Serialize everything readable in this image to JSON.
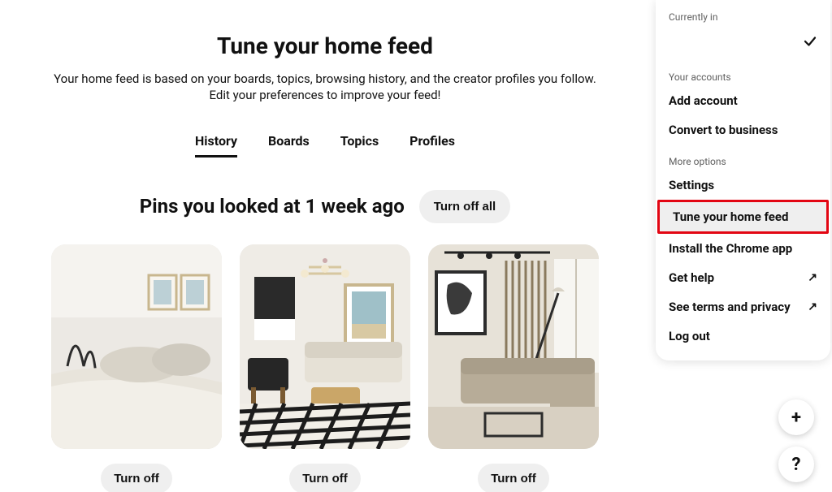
{
  "header": {
    "title": "Tune your home feed",
    "subtitle_line1": "Your home feed is based on your boards, topics, browsing history, and the creator profiles you follow.",
    "subtitle_line2": "Edit your preferences to improve your feed!"
  },
  "tabs": {
    "history": "History",
    "boards": "Boards",
    "topics": "Topics",
    "profiles": "Profiles",
    "active": "history"
  },
  "section": {
    "title": "Pins you looked at 1 week ago",
    "turn_off_all": "Turn off all"
  },
  "pins": [
    {
      "turn_off": "Turn off",
      "alt": "bedroom-interior"
    },
    {
      "turn_off": "Turn off",
      "alt": "living-room-plaid-rug"
    },
    {
      "turn_off": "Turn off",
      "alt": "modern-living-room"
    }
  ],
  "panel": {
    "currently_in_label": "Currently in",
    "your_accounts_label": "Your accounts",
    "add_account": "Add account",
    "convert_business": "Convert to business",
    "more_options_label": "More options",
    "settings": "Settings",
    "tune_feed": "Tune your home feed",
    "install_chrome": "Install the Chrome app",
    "get_help": "Get help",
    "see_terms": "See terms and privacy",
    "log_out": "Log out",
    "external_glyph": "↗"
  },
  "fab": {
    "plus": "+",
    "help": "?"
  }
}
